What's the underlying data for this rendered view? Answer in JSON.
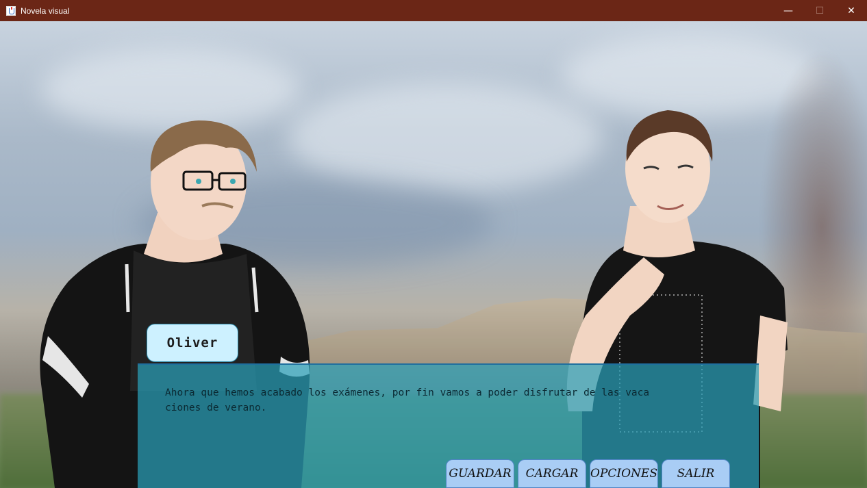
{
  "window": {
    "title": "Novela visual",
    "controls": {
      "minimize": "—",
      "maximize": "☐",
      "close": "✕"
    },
    "colors": {
      "titlebar": "#6b2616"
    }
  },
  "scene": {
    "speaker": "Oliver",
    "dialogue": "Ahora que hemos acabado los exámenes, por fin vamos a poder disfrutar de las vaca\nciones de verano."
  },
  "menu": {
    "save_label": "GUARDAR",
    "load_label": "CARGAR",
    "options_label": "OPCIONES",
    "exit_label": "SALIR"
  },
  "colors": {
    "dialog_box": "#2aa0b8",
    "name_box": "#cdf1ff",
    "menu_button": "#a9cdf5"
  }
}
